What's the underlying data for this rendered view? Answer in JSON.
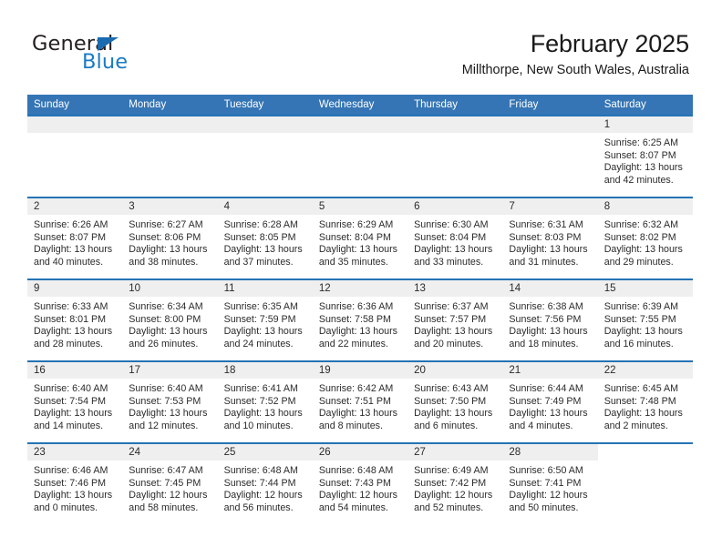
{
  "logo": {
    "word_top": "General",
    "word_bottom": "Blue",
    "triangle_color": "#1a6bb0",
    "blue_color": "#1a7bc4"
  },
  "header": {
    "title": "February 2025",
    "subtitle": "Millthorpe, New South Wales, Australia"
  },
  "colors": {
    "header_blue": "#3575b5",
    "row_rule_blue": "#2573b4",
    "daynum_band": "#efefef",
    "text": "#2b2b2b"
  },
  "weekdays": [
    "Sunday",
    "Monday",
    "Tuesday",
    "Wednesday",
    "Thursday",
    "Friday",
    "Saturday"
  ],
  "weeks": [
    [
      {
        "day": "",
        "blank": true,
        "band": true
      },
      {
        "day": "",
        "blank": true,
        "band": true
      },
      {
        "day": "",
        "blank": true,
        "band": true
      },
      {
        "day": "",
        "blank": true,
        "band": true
      },
      {
        "day": "",
        "blank": true,
        "band": true
      },
      {
        "day": "",
        "blank": true,
        "band": true
      },
      {
        "day": "1",
        "sunrise": "Sunrise: 6:25 AM",
        "sunset": "Sunset: 8:07 PM",
        "daylight1": "Daylight: 13 hours",
        "daylight2": "and 42 minutes."
      }
    ],
    [
      {
        "day": "2",
        "sunrise": "Sunrise: 6:26 AM",
        "sunset": "Sunset: 8:07 PM",
        "daylight1": "Daylight: 13 hours",
        "daylight2": "and 40 minutes."
      },
      {
        "day": "3",
        "sunrise": "Sunrise: 6:27 AM",
        "sunset": "Sunset: 8:06 PM",
        "daylight1": "Daylight: 13 hours",
        "daylight2": "and 38 minutes."
      },
      {
        "day": "4",
        "sunrise": "Sunrise: 6:28 AM",
        "sunset": "Sunset: 8:05 PM",
        "daylight1": "Daylight: 13 hours",
        "daylight2": "and 37 minutes."
      },
      {
        "day": "5",
        "sunrise": "Sunrise: 6:29 AM",
        "sunset": "Sunset: 8:04 PM",
        "daylight1": "Daylight: 13 hours",
        "daylight2": "and 35 minutes."
      },
      {
        "day": "6",
        "sunrise": "Sunrise: 6:30 AM",
        "sunset": "Sunset: 8:04 PM",
        "daylight1": "Daylight: 13 hours",
        "daylight2": "and 33 minutes."
      },
      {
        "day": "7",
        "sunrise": "Sunrise: 6:31 AM",
        "sunset": "Sunset: 8:03 PM",
        "daylight1": "Daylight: 13 hours",
        "daylight2": "and 31 minutes."
      },
      {
        "day": "8",
        "sunrise": "Sunrise: 6:32 AM",
        "sunset": "Sunset: 8:02 PM",
        "daylight1": "Daylight: 13 hours",
        "daylight2": "and 29 minutes."
      }
    ],
    [
      {
        "day": "9",
        "sunrise": "Sunrise: 6:33 AM",
        "sunset": "Sunset: 8:01 PM",
        "daylight1": "Daylight: 13 hours",
        "daylight2": "and 28 minutes."
      },
      {
        "day": "10",
        "sunrise": "Sunrise: 6:34 AM",
        "sunset": "Sunset: 8:00 PM",
        "daylight1": "Daylight: 13 hours",
        "daylight2": "and 26 minutes."
      },
      {
        "day": "11",
        "sunrise": "Sunrise: 6:35 AM",
        "sunset": "Sunset: 7:59 PM",
        "daylight1": "Daylight: 13 hours",
        "daylight2": "and 24 minutes."
      },
      {
        "day": "12",
        "sunrise": "Sunrise: 6:36 AM",
        "sunset": "Sunset: 7:58 PM",
        "daylight1": "Daylight: 13 hours",
        "daylight2": "and 22 minutes."
      },
      {
        "day": "13",
        "sunrise": "Sunrise: 6:37 AM",
        "sunset": "Sunset: 7:57 PM",
        "daylight1": "Daylight: 13 hours",
        "daylight2": "and 20 minutes."
      },
      {
        "day": "14",
        "sunrise": "Sunrise: 6:38 AM",
        "sunset": "Sunset: 7:56 PM",
        "daylight1": "Daylight: 13 hours",
        "daylight2": "and 18 minutes."
      },
      {
        "day": "15",
        "sunrise": "Sunrise: 6:39 AM",
        "sunset": "Sunset: 7:55 PM",
        "daylight1": "Daylight: 13 hours",
        "daylight2": "and 16 minutes."
      }
    ],
    [
      {
        "day": "16",
        "sunrise": "Sunrise: 6:40 AM",
        "sunset": "Sunset: 7:54 PM",
        "daylight1": "Daylight: 13 hours",
        "daylight2": "and 14 minutes."
      },
      {
        "day": "17",
        "sunrise": "Sunrise: 6:40 AM",
        "sunset": "Sunset: 7:53 PM",
        "daylight1": "Daylight: 13 hours",
        "daylight2": "and 12 minutes."
      },
      {
        "day": "18",
        "sunrise": "Sunrise: 6:41 AM",
        "sunset": "Sunset: 7:52 PM",
        "daylight1": "Daylight: 13 hours",
        "daylight2": "and 10 minutes."
      },
      {
        "day": "19",
        "sunrise": "Sunrise: 6:42 AM",
        "sunset": "Sunset: 7:51 PM",
        "daylight1": "Daylight: 13 hours",
        "daylight2": "and 8 minutes."
      },
      {
        "day": "20",
        "sunrise": "Sunrise: 6:43 AM",
        "sunset": "Sunset: 7:50 PM",
        "daylight1": "Daylight: 13 hours",
        "daylight2": "and 6 minutes."
      },
      {
        "day": "21",
        "sunrise": "Sunrise: 6:44 AM",
        "sunset": "Sunset: 7:49 PM",
        "daylight1": "Daylight: 13 hours",
        "daylight2": "and 4 minutes."
      },
      {
        "day": "22",
        "sunrise": "Sunrise: 6:45 AM",
        "sunset": "Sunset: 7:48 PM",
        "daylight1": "Daylight: 13 hours",
        "daylight2": "and 2 minutes."
      }
    ],
    [
      {
        "day": "23",
        "sunrise": "Sunrise: 6:46 AM",
        "sunset": "Sunset: 7:46 PM",
        "daylight1": "Daylight: 13 hours",
        "daylight2": "and 0 minutes."
      },
      {
        "day": "24",
        "sunrise": "Sunrise: 6:47 AM",
        "sunset": "Sunset: 7:45 PM",
        "daylight1": "Daylight: 12 hours",
        "daylight2": "and 58 minutes."
      },
      {
        "day": "25",
        "sunrise": "Sunrise: 6:48 AM",
        "sunset": "Sunset: 7:44 PM",
        "daylight1": "Daylight: 12 hours",
        "daylight2": "and 56 minutes."
      },
      {
        "day": "26",
        "sunrise": "Sunrise: 6:48 AM",
        "sunset": "Sunset: 7:43 PM",
        "daylight1": "Daylight: 12 hours",
        "daylight2": "and 54 minutes."
      },
      {
        "day": "27",
        "sunrise": "Sunrise: 6:49 AM",
        "sunset": "Sunset: 7:42 PM",
        "daylight1": "Daylight: 12 hours",
        "daylight2": "and 52 minutes."
      },
      {
        "day": "28",
        "sunrise": "Sunrise: 6:50 AM",
        "sunset": "Sunset: 7:41 PM",
        "daylight1": "Daylight: 12 hours",
        "daylight2": "and 50 minutes."
      },
      {
        "day": "",
        "blank": true,
        "band": false
      }
    ]
  ]
}
